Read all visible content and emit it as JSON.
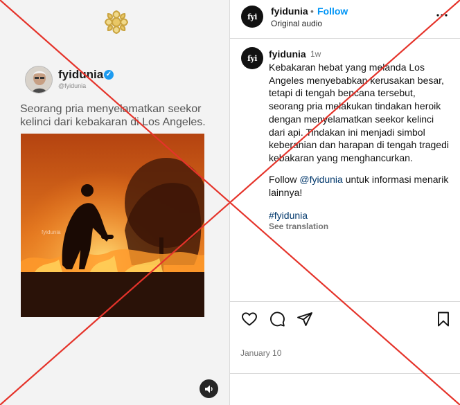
{
  "post_media": {
    "tweet": {
      "name": "fyidunia",
      "handle": "@fyidunia",
      "text": "Seorang pria menyelamatkan seekor kelinci dari kebakaran di Los Angeles."
    },
    "watermark": "fyidunia"
  },
  "header": {
    "username": "fyidunia",
    "separator": "•",
    "follow_label": "Follow",
    "audio_label": "Original audio",
    "avatar_text": "fyi"
  },
  "caption": {
    "username": "fyidunia",
    "time_ago": "1w",
    "body": "Kebakaran hebat yang melanda Los Angeles menyebabkan kerusakan besar, tetapi di tengah bencana tersebut, seorang pria melakukan tindakan heroik dengan menyelamatkan seekor kelinci dari api. Tindakan ini menjadi simbol keberanian dan harapan di tengah tragedi kebakaran yang menghancurkan.",
    "follow_prefix": "Follow ",
    "follow_mention": "@fyidunia",
    "follow_suffix": " untuk informasi menarik lainnya!",
    "hashtag": "#fyidunia",
    "see_translation": "See translation"
  },
  "actions": {
    "icons": [
      "heart-icon",
      "comment-icon",
      "share-icon",
      "bookmark-icon"
    ]
  },
  "date": "January 10",
  "colors": {
    "accent": "#0095f6",
    "link": "#00376b",
    "overlay_x": "#e5332a"
  }
}
